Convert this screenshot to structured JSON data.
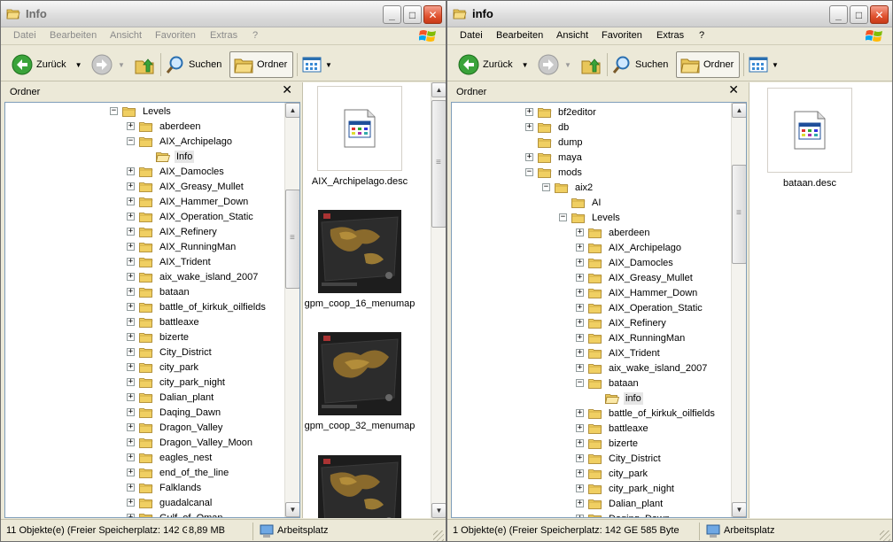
{
  "left": {
    "title": "Info",
    "menu": [
      "Datei",
      "Bearbeiten",
      "Ansicht",
      "Favoriten",
      "Extras",
      "?"
    ],
    "toolbar": {
      "back": "Zurück",
      "search": "Suchen",
      "folders": "Ordner"
    },
    "pane_title": "Ordner",
    "tree": [
      {
        "label": "Levels",
        "level": 0,
        "expand": "minus"
      },
      {
        "label": "aberdeen",
        "level": 1,
        "expand": "plus"
      },
      {
        "label": "AIX_Archipelago",
        "level": 1,
        "expand": "minus"
      },
      {
        "label": "Info",
        "level": 2,
        "expand": "none",
        "selected": true,
        "open": true
      },
      {
        "label": "AIX_Damocles",
        "level": 1,
        "expand": "plus"
      },
      {
        "label": "AIX_Greasy_Mullet",
        "level": 1,
        "expand": "plus"
      },
      {
        "label": "AIX_Hammer_Down",
        "level": 1,
        "expand": "plus"
      },
      {
        "label": "AIX_Operation_Static",
        "level": 1,
        "expand": "plus"
      },
      {
        "label": "AIX_Refinery",
        "level": 1,
        "expand": "plus"
      },
      {
        "label": "AIX_RunningMan",
        "level": 1,
        "expand": "plus"
      },
      {
        "label": "AIX_Trident",
        "level": 1,
        "expand": "plus"
      },
      {
        "label": "aix_wake_island_2007",
        "level": 1,
        "expand": "plus"
      },
      {
        "label": "bataan",
        "level": 1,
        "expand": "plus"
      },
      {
        "label": "battle_of_kirkuk_oilfields",
        "level": 1,
        "expand": "plus"
      },
      {
        "label": "battleaxe",
        "level": 1,
        "expand": "plus"
      },
      {
        "label": "bizerte",
        "level": 1,
        "expand": "plus"
      },
      {
        "label": "City_District",
        "level": 1,
        "expand": "plus"
      },
      {
        "label": "city_park",
        "level": 1,
        "expand": "plus"
      },
      {
        "label": "city_park_night",
        "level": 1,
        "expand": "plus"
      },
      {
        "label": "Dalian_plant",
        "level": 1,
        "expand": "plus"
      },
      {
        "label": "Daqing_Dawn",
        "level": 1,
        "expand": "plus"
      },
      {
        "label": "Dragon_Valley",
        "level": 1,
        "expand": "plus"
      },
      {
        "label": "Dragon_Valley_Moon",
        "level": 1,
        "expand": "plus"
      },
      {
        "label": "eagles_nest",
        "level": 1,
        "expand": "plus"
      },
      {
        "label": "end_of_the_line",
        "level": 1,
        "expand": "plus"
      },
      {
        "label": "Falklands",
        "level": 1,
        "expand": "plus"
      },
      {
        "label": "guadalcanal",
        "level": 1,
        "expand": "plus"
      },
      {
        "label": "Gulf_of_Oman",
        "level": 1,
        "expand": "plus"
      }
    ],
    "files": [
      {
        "name": "AIX_Archipelago.desc",
        "kind": "doc"
      },
      {
        "name": "gpm_coop_16_menumap",
        "kind": "map"
      },
      {
        "name": "gpm_coop_32_menumap",
        "kind": "map"
      },
      {
        "name": "",
        "kind": "map"
      }
    ],
    "status": {
      "objects": "11 Objekte(e) (Freier Speicherplatz: 142 G",
      "size": "8,89 MB",
      "location": "Arbeitsplatz"
    }
  },
  "right": {
    "title": "info",
    "menu": [
      "Datei",
      "Bearbeiten",
      "Ansicht",
      "Favoriten",
      "Extras",
      "?"
    ],
    "toolbar": {
      "back": "Zurück",
      "search": "Suchen",
      "folders": "Ordner"
    },
    "pane_title": "Ordner",
    "tree": [
      {
        "label": "bf2editor",
        "level": 0,
        "expand": "plus"
      },
      {
        "label": "db",
        "level": 0,
        "expand": "plus"
      },
      {
        "label": "dump",
        "level": 0,
        "expand": "none"
      },
      {
        "label": "maya",
        "level": 0,
        "expand": "plus"
      },
      {
        "label": "mods",
        "level": 0,
        "expand": "minus"
      },
      {
        "label": "aix2",
        "level": 1,
        "expand": "minus"
      },
      {
        "label": "AI",
        "level": 2,
        "expand": "none"
      },
      {
        "label": "Levels",
        "level": 2,
        "expand": "minus"
      },
      {
        "label": "aberdeen",
        "level": 3,
        "expand": "plus"
      },
      {
        "label": "AIX_Archipelago",
        "level": 3,
        "expand": "plus"
      },
      {
        "label": "AIX_Damocles",
        "level": 3,
        "expand": "plus"
      },
      {
        "label": "AIX_Greasy_Mullet",
        "level": 3,
        "expand": "plus"
      },
      {
        "label": "AIX_Hammer_Down",
        "level": 3,
        "expand": "plus"
      },
      {
        "label": "AIX_Operation_Static",
        "level": 3,
        "expand": "plus"
      },
      {
        "label": "AIX_Refinery",
        "level": 3,
        "expand": "plus"
      },
      {
        "label": "AIX_RunningMan",
        "level": 3,
        "expand": "plus"
      },
      {
        "label": "AIX_Trident",
        "level": 3,
        "expand": "plus"
      },
      {
        "label": "aix_wake_island_2007",
        "level": 3,
        "expand": "plus"
      },
      {
        "label": "bataan",
        "level": 3,
        "expand": "minus"
      },
      {
        "label": "info",
        "level": 4,
        "expand": "none",
        "selected": true,
        "open": true
      },
      {
        "label": "battle_of_kirkuk_oilfields",
        "level": 3,
        "expand": "plus"
      },
      {
        "label": "battleaxe",
        "level": 3,
        "expand": "plus"
      },
      {
        "label": "bizerte",
        "level": 3,
        "expand": "plus"
      },
      {
        "label": "City_District",
        "level": 3,
        "expand": "plus"
      },
      {
        "label": "city_park",
        "level": 3,
        "expand": "plus"
      },
      {
        "label": "city_park_night",
        "level": 3,
        "expand": "plus"
      },
      {
        "label": "Dalian_plant",
        "level": 3,
        "expand": "plus"
      },
      {
        "label": "Daqing_Dawn",
        "level": 3,
        "expand": "plus"
      }
    ],
    "files": [
      {
        "name": "bataan.desc",
        "kind": "doc"
      }
    ],
    "status": {
      "objects": "1 Objekte(e) (Freier Speicherplatz: 142 GE 585 Byte",
      "location": "Arbeitsplatz"
    }
  }
}
